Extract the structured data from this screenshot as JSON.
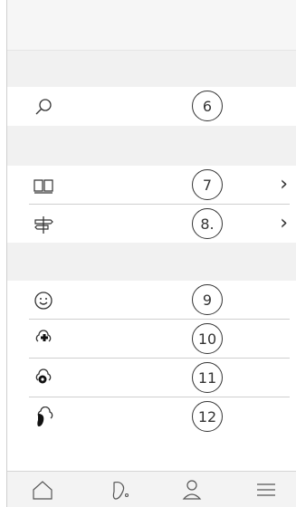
{
  "list": {
    "items": [
      {
        "icon": "search-icon",
        "badge": "6",
        "chevron": ""
      },
      {
        "icon": "book-icon",
        "badge": "7",
        "chevron": "›"
      },
      {
        "icon": "signpost-icon",
        "badge": "8.",
        "chevron": "›"
      },
      {
        "icon": "smiley-icon",
        "badge": "9",
        "chevron": ""
      },
      {
        "icon": "cloud-plus-icon",
        "badge": "10",
        "chevron": ""
      },
      {
        "icon": "cloud-gear-icon",
        "badge": "11",
        "chevron": ""
      },
      {
        "icon": "cloud-hearing-aid-icon",
        "badge": "12",
        "chevron": ""
      }
    ]
  },
  "tabbar": {
    "tabs": [
      {
        "icon": "home-icon"
      },
      {
        "icon": "hearing-aid-icon"
      },
      {
        "icon": "profile-icon"
      },
      {
        "icon": "menu-icon"
      }
    ]
  }
}
